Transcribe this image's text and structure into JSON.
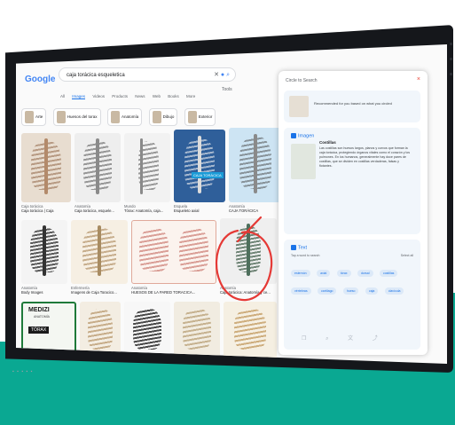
{
  "search": {
    "logo": "Google",
    "query": "caja torácica esqueletica",
    "tools": "Tools"
  },
  "tabs": [
    "All",
    "Images",
    "Videos",
    "Products",
    "News",
    "Web",
    "Books",
    "More"
  ],
  "active_tab": 1,
  "chips": [
    "Arte",
    "Huesos del torax",
    "Anatomía",
    "Dibujo",
    "Exterior"
  ],
  "results": [
    {
      "source": "Caja torácica",
      "title": "Caja torácica | Caja"
    },
    {
      "source": "Anatomía",
      "title": "Caja torácica, esquele..."
    },
    {
      "source": "Mundo",
      "title": "Tórax: Anatomía, caja..."
    },
    {
      "source": "Esquela",
      "title": "Esqueleto axial"
    },
    {
      "source": "Anatomía",
      "title": "CAJA TORÁCICA"
    },
    {
      "source": "Anatomía",
      "title": "Body Images"
    },
    {
      "source": "Enfermería",
      "title": "Imagens de Caja Toracico..."
    },
    {
      "source": "Anatomía",
      "title": "HUESOS DE LA PARED TORACICA..."
    },
    {
      "source": "Anatomía",
      "title": "Caja torácica: Anatomía y ce..."
    }
  ],
  "tile_text": {
    "banner": "CAJA TORÁCICA",
    "medizi": "MEDIZI",
    "medizi_sub": "ANATOMÍA",
    "torax": "TÓRAX"
  },
  "panel": {
    "header": "Circle to Search",
    "preview_text": "Recommended for you based on what you circled",
    "image_title": "Imagen",
    "image_body_title": "Costillas",
    "image_body": "Las costillas son huesos largos, planos y curvos que forman la caja torácica, protegiendo órganos vitales como el corazón y los pulmones. En los humanos, generalmente hay doce pares de costillas, que se dividen en costillas verdaderas, falsas y flotantes.",
    "text_title": "Text",
    "text_sub": "Tap a word to search",
    "select_all": "Select all",
    "tags": [
      "esternón",
      "axial",
      "tórax",
      "dorsal",
      "costillas",
      "vértebras",
      "cartílago",
      "hueso",
      "caja",
      "clavícula"
    ],
    "tools": [
      "copy",
      "search",
      "translate",
      "share"
    ]
  },
  "colors": {
    "accent": "#1a73e8",
    "teal": "#0aa892",
    "circle": "#e53935"
  }
}
